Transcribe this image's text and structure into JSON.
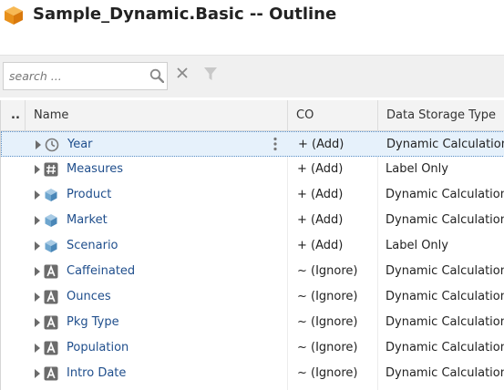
{
  "window": {
    "title": "Sample_Dynamic.Basic -- Outline",
    "title_icon": "cube-icon",
    "accent_color": "#f5a623"
  },
  "toolbar": {
    "search_placeholder": "search ...",
    "search_value": "",
    "icons": [
      "search-icon",
      "clear-icon",
      "filter-icon"
    ]
  },
  "grid": {
    "columns": [
      "..",
      "Name",
      "CO",
      "Data Storage Type"
    ],
    "rows": [
      {
        "name": "Year",
        "icon": "clock-icon",
        "co": "+ (Add)",
        "storage": "Dynamic Calculation",
        "selected": true
      },
      {
        "name": "Measures",
        "icon": "hash-icon",
        "co": "+ (Add)",
        "storage": "Label Only",
        "selected": false
      },
      {
        "name": "Product",
        "icon": "cube-dimension-icon",
        "co": "+ (Add)",
        "storage": "Dynamic Calculation",
        "selected": false
      },
      {
        "name": "Market",
        "icon": "cube-dimension-icon",
        "co": "+ (Add)",
        "storage": "Dynamic Calculation",
        "selected": false
      },
      {
        "name": "Scenario",
        "icon": "cube-dimension-icon",
        "co": "+ (Add)",
        "storage": "Label Only",
        "selected": false
      },
      {
        "name": "Caffeinated",
        "icon": "attribute-icon",
        "co": "~ (Ignore)",
        "storage": "Dynamic Calculation",
        "selected": false
      },
      {
        "name": "Ounces",
        "icon": "attribute-icon",
        "co": "~ (Ignore)",
        "storage": "Dynamic Calculation",
        "selected": false
      },
      {
        "name": "Pkg Type",
        "icon": "attribute-icon",
        "co": "~ (Ignore)",
        "storage": "Dynamic Calculation",
        "selected": false
      },
      {
        "name": "Population",
        "icon": "attribute-icon",
        "co": "~ (Ignore)",
        "storage": "Dynamic Calculation",
        "selected": false
      },
      {
        "name": "Intro Date",
        "icon": "attribute-icon",
        "co": "~ (Ignore)",
        "storage": "Dynamic Calculation",
        "selected": false
      }
    ]
  }
}
